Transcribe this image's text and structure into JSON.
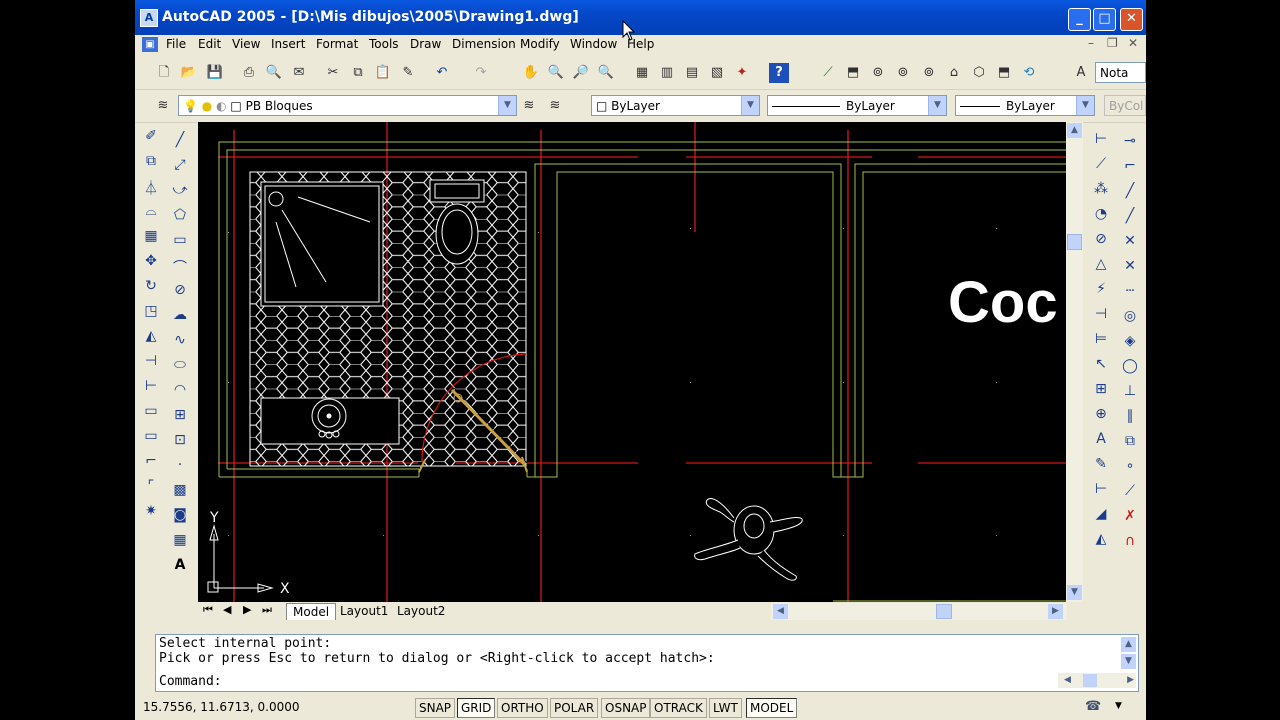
{
  "window": {
    "title": "AutoCAD 2005 - [D:\\Mis dibujos\\2005\\Drawing1.dwg]"
  },
  "menu": {
    "items": [
      "File",
      "Edit",
      "View",
      "Insert",
      "Format",
      "Tools",
      "Draw",
      "Dimension",
      "Modify",
      "Window",
      "Help"
    ]
  },
  "toolbar": {
    "text_style": "Nota"
  },
  "layers": {
    "current_layer": "PB Bloques",
    "color": "ByLayer",
    "linetype": "ByLayer",
    "lineweight": "ByLayer",
    "plotstyle": "ByCol"
  },
  "drawing": {
    "room_label": "Coc",
    "ucs_x": "X",
    "ucs_y": "Y",
    "colors": {
      "background": "#000000",
      "wall_red": "#d01818",
      "wall_green": "#9bbf4a",
      "lines_white": "#ffffff"
    }
  },
  "tabs": [
    "Model",
    "Layout1",
    "Layout2"
  ],
  "command": {
    "line1": "Select internal point:",
    "line2": "Pick or press Esc to return to dialog or <Right-click to accept hatch>:",
    "prompt": "Command:"
  },
  "status": {
    "coordinates": "15.7556, 11.6713, 0.0000",
    "buttons": [
      "SNAP",
      "GRID",
      "ORTHO",
      "POLAR",
      "OSNAP",
      "OTRACK",
      "LWT",
      "MODEL"
    ]
  }
}
